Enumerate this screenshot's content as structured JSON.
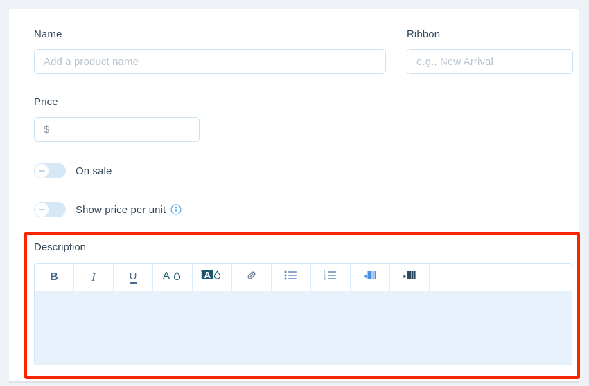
{
  "form": {
    "name": {
      "label": "Name",
      "placeholder": "Add a product name",
      "value": ""
    },
    "ribbon": {
      "label": "Ribbon",
      "placeholder": "e.g., New Arrival",
      "value": ""
    },
    "price": {
      "label": "Price",
      "prefix": "$",
      "placeholder": "",
      "value": ""
    },
    "toggles": [
      {
        "label": "On sale",
        "state": "off",
        "has_info_icon": false
      },
      {
        "label": "Show price per unit",
        "state": "off",
        "has_info_icon": true,
        "info_icon": "info-circle-icon"
      }
    ],
    "description": {
      "label": "Description",
      "value": "",
      "toolbar": [
        {
          "name": "bold-button",
          "glyph": "B",
          "icon": "bold-icon"
        },
        {
          "name": "italic-button",
          "glyph": "I",
          "icon": "italic-icon"
        },
        {
          "name": "underline-button",
          "glyph": "U",
          "icon": "underline-icon"
        },
        {
          "name": "text-color-button",
          "glyph": "",
          "icon": "text-color-icon"
        },
        {
          "name": "highlight-color-button",
          "glyph": "",
          "icon": "highlight-color-icon"
        },
        {
          "name": "link-button",
          "glyph": "",
          "icon": "link-icon"
        },
        {
          "name": "bulleted-list-button",
          "glyph": "",
          "icon": "bulleted-list-icon"
        },
        {
          "name": "numbered-list-button",
          "glyph": "",
          "icon": "numbered-list-icon"
        },
        {
          "name": "ltr-direction-button",
          "glyph": "",
          "icon": "paragraph-ltr-icon"
        },
        {
          "name": "rtl-direction-button",
          "glyph": "",
          "icon": "paragraph-rtl-icon"
        }
      ]
    }
  },
  "annotation": {
    "highlight_color": "#f92400",
    "highlight_target": "description"
  },
  "colors": {
    "page_background": "#eef1f5",
    "card_background": "#ffffff",
    "label_text": "#32475c",
    "placeholder_text": "#b8c4cf",
    "input_border": "#c9e3f7",
    "toggle_track_off": "#d6e8f8",
    "editor_body": "#e8f2fc",
    "toolbar_icon_dark": "#1d5871",
    "toolbar_icon_blue": "#4a90e2",
    "accent_red": "#f92400"
  }
}
